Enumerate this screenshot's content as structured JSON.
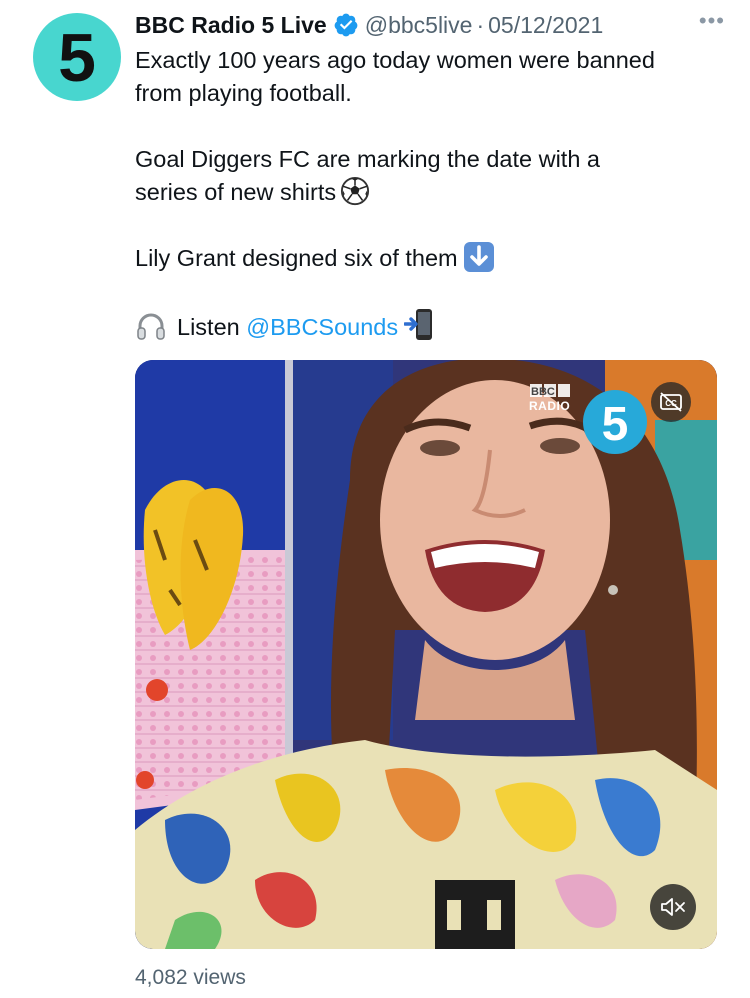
{
  "account": {
    "display_name": "BBC Radio 5 Live",
    "handle": "@bbc5live",
    "separator": "·",
    "date": "05/12/2021",
    "avatar_text": "5",
    "verified": true
  },
  "tweet": {
    "line1": "Exactly 100 years ago today women were banned",
    "line2": "from playing football.",
    "line3": "Goal Diggers FC are marking the date with a",
    "line4": "series of new shirts",
    "line5": "Lily Grant designed six of them",
    "listen_label": "Listen",
    "mention": "@BBCSounds",
    "emojis": [
      "soccer-ball",
      "down-arrow",
      "mobile-phone-arrow",
      "headphones"
    ]
  },
  "media": {
    "logo_text_top": "BBC",
    "logo_text_bottom": "RADIO",
    "logo_number": "5",
    "captions_icon": "cc-icon",
    "mute_icon": "speaker-muted-icon"
  },
  "footer": {
    "views": "4,082 views"
  },
  "colors": {
    "avatar_bg": "#48d6cf",
    "verified": "#1d9bf0",
    "link": "#1d9bf0",
    "secondary_text": "#536471"
  }
}
